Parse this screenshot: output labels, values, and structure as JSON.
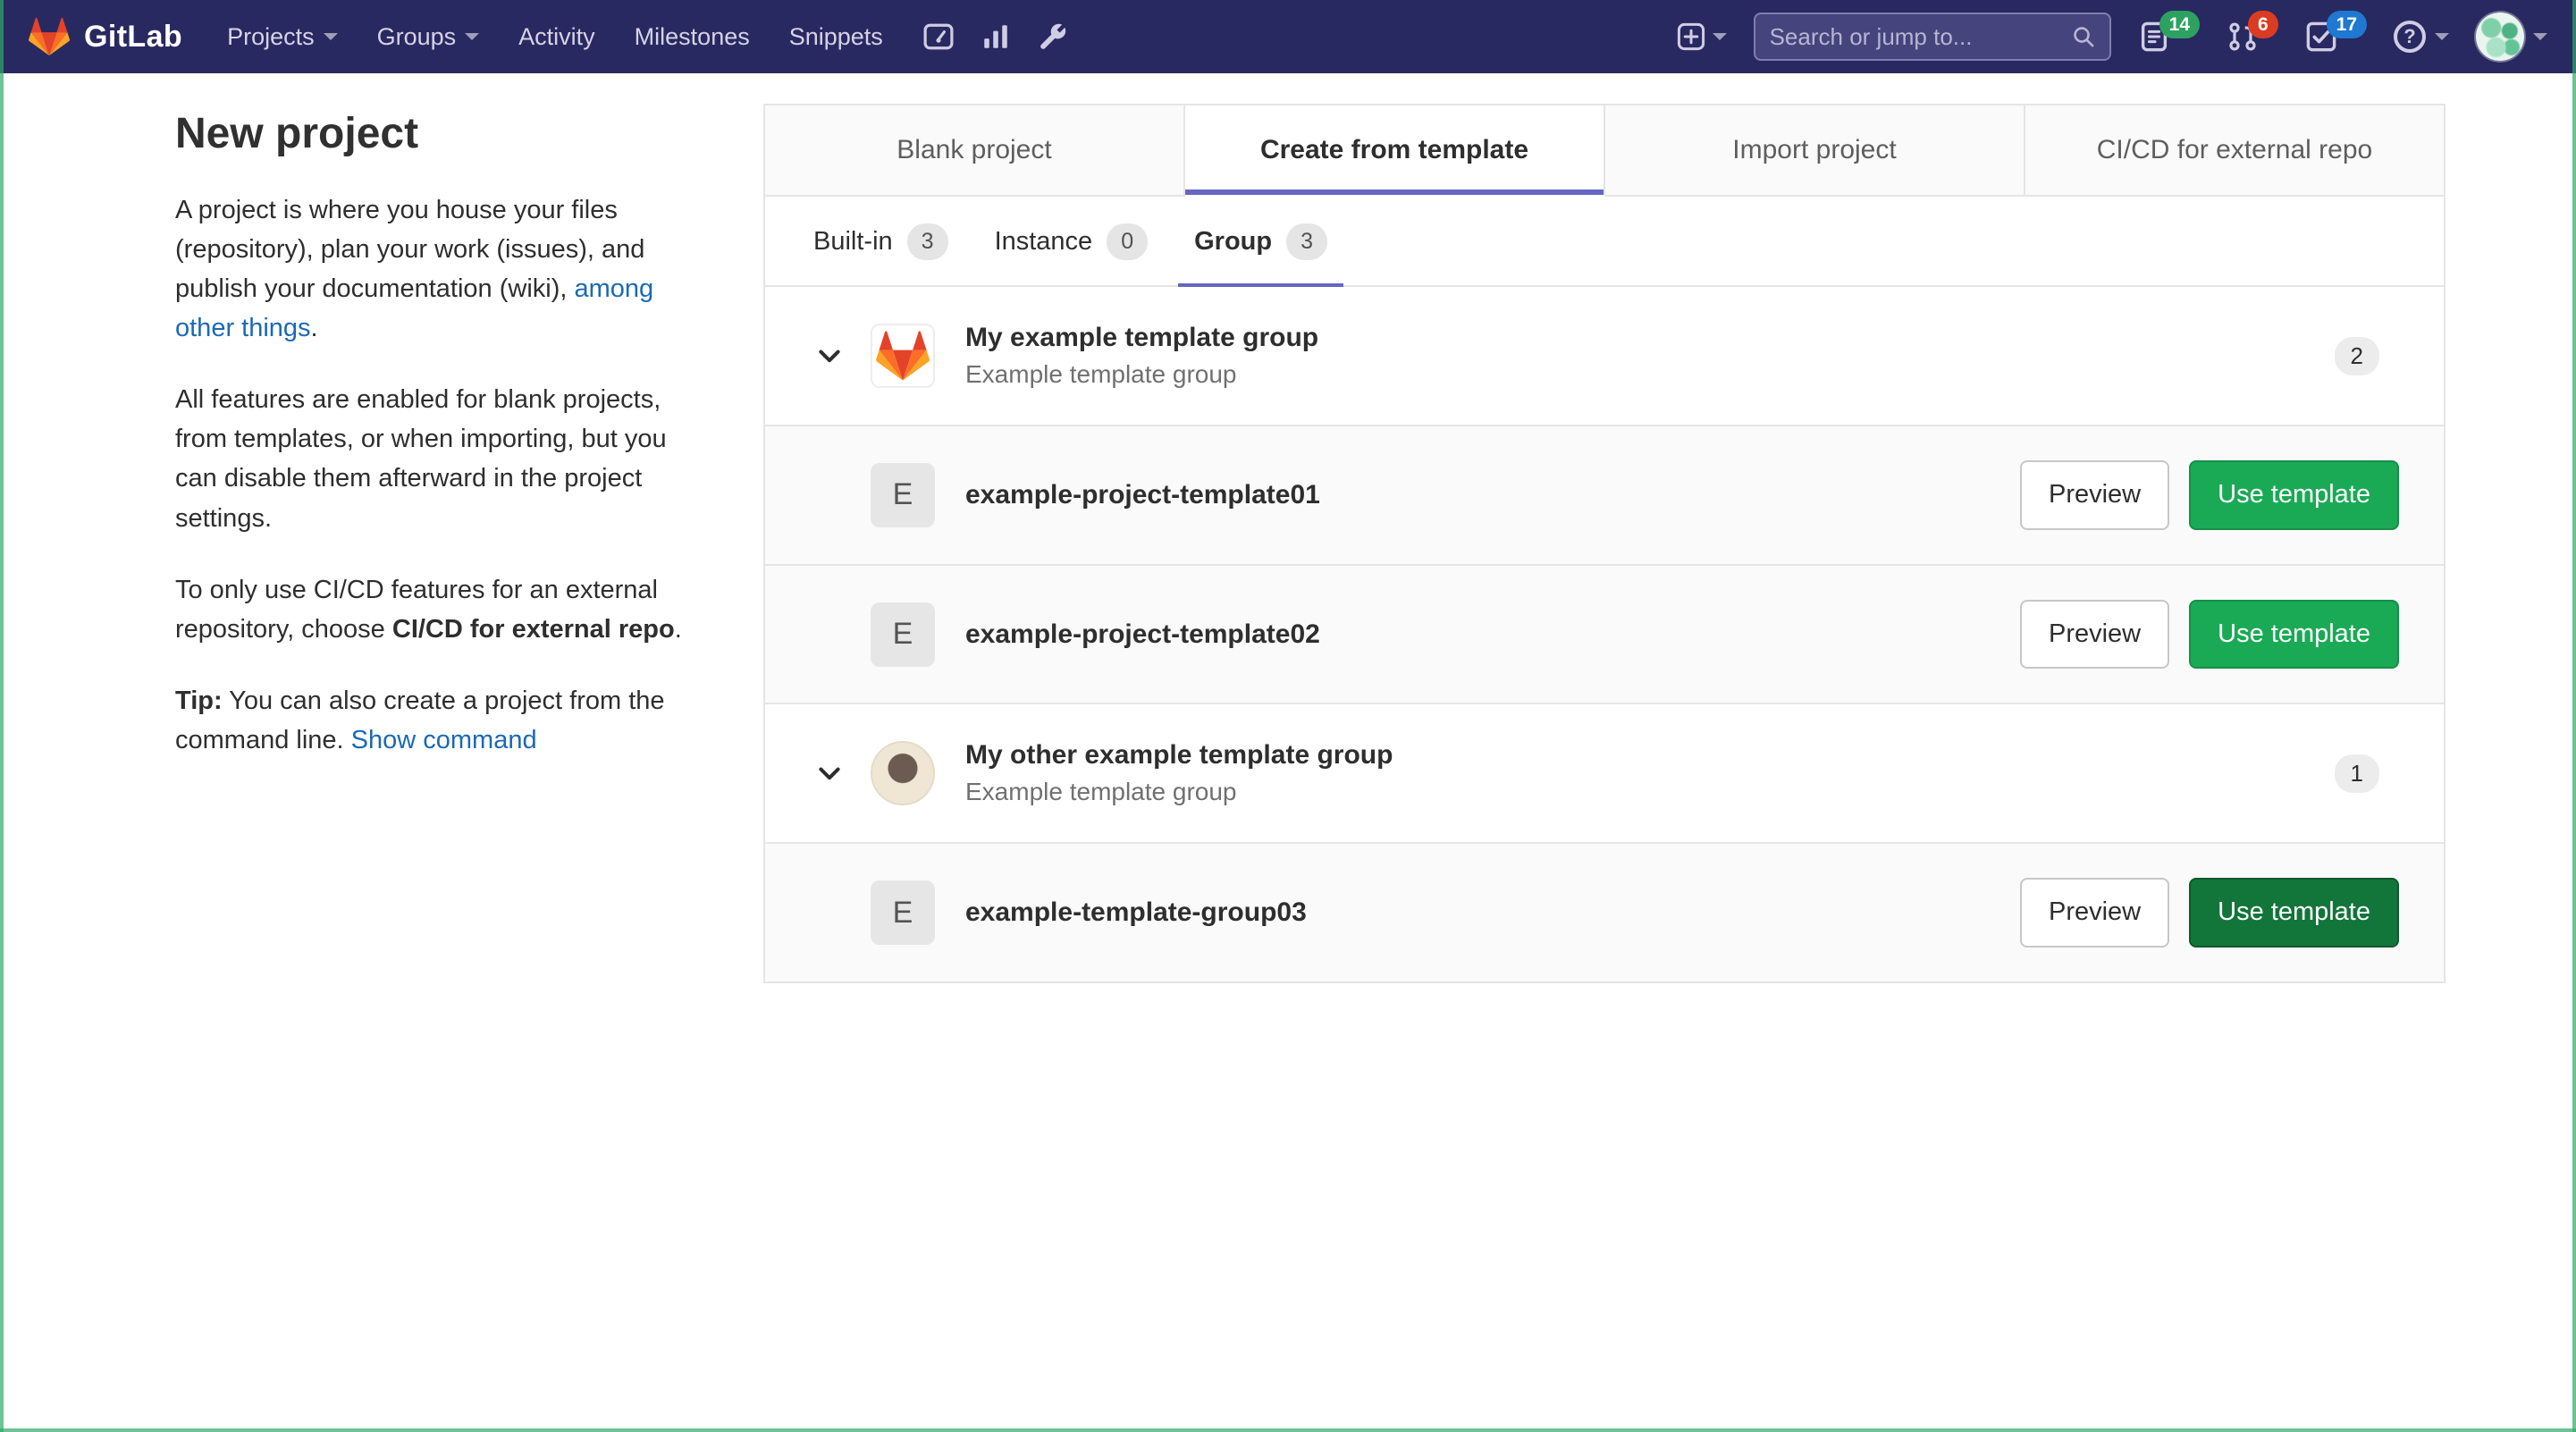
{
  "colors": {
    "navbar_bg": "#292961",
    "accent_indigo": "#6666c4",
    "button_green": "#1aaa55",
    "button_green_dark": "#12753a",
    "link_blue": "#1b69b6",
    "badge_green": "#2da160",
    "badge_red": "#db3b21",
    "badge_blue": "#1f78d1",
    "border": "#e5e5e5"
  },
  "icons": {
    "brand": "gitlab-tanuki-icon",
    "nav_shortcuts": [
      "dashboard-icon",
      "charts-icon",
      "admin-wrench-icon"
    ],
    "right": [
      "plus-square-icon",
      "search-icon",
      "issues-icon",
      "merge-request-icon",
      "todos-check-icon",
      "question-icon",
      "chevron-down-icon"
    ]
  },
  "navbar": {
    "brand": "GitLab",
    "links": [
      "Projects",
      "Groups",
      "Activity",
      "Milestones",
      "Snippets"
    ],
    "search_placeholder": "Search or jump to...",
    "issues_count": "14",
    "merge_requests_count": "6",
    "todos_count": "17",
    "help_glyph": "?"
  },
  "intro": {
    "title": "New project",
    "p1_before": "A project is where you house your files (repository), plan your work (issues), and publish your documentation (wiki), ",
    "p1_link": "among other things",
    "p1_after": ".",
    "p2": "All features are enabled for blank projects, from templates, or when importing, but you can disable them afterward in the project settings.",
    "p3_before": "To only use CI/CD features for an external repository, choose ",
    "p3_bold": "CI/CD for external repo",
    "p3_after": ".",
    "tip_bold": "Tip:",
    "tip_text": " You can also create a project from the command line. ",
    "tip_link": "Show command"
  },
  "tabs": [
    {
      "label": "Blank project",
      "active": false
    },
    {
      "label": "Create from template",
      "active": true
    },
    {
      "label": "Import project",
      "active": false
    },
    {
      "label": "CI/CD for external repo",
      "active": false
    }
  ],
  "subtabs": [
    {
      "label": "Built-in",
      "count": "3",
      "active": false
    },
    {
      "label": "Instance",
      "count": "0",
      "active": false
    },
    {
      "label": "Group",
      "count": "3",
      "active": true
    }
  ],
  "groups": [
    {
      "name": "My example template group",
      "description": "Example template group",
      "count": "2",
      "templates": [
        {
          "initial": "E",
          "name": "example-project-template01"
        },
        {
          "initial": "E",
          "name": "example-project-template02"
        }
      ]
    },
    {
      "name": "My other example template group",
      "description": "Example template group",
      "count": "1",
      "templates": [
        {
          "initial": "E",
          "name": "example-template-group03"
        }
      ]
    }
  ],
  "buttons": {
    "preview": "Preview",
    "use_template": "Use template"
  }
}
